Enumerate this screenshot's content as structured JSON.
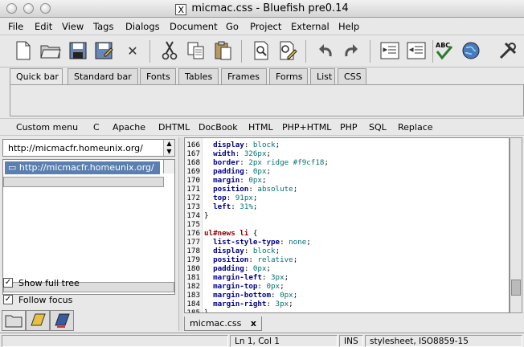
{
  "window": {
    "title": "micmac.css - Bluefish pre0.14",
    "x_glyph": "X"
  },
  "menu": [
    "File",
    "Edit",
    "View",
    "Tags",
    "Dialogs",
    "Document",
    "Go",
    "Project",
    "External",
    "Help"
  ],
  "toolbar_icons": [
    "new-file-icon",
    "open-folder-icon",
    "save-icon",
    "save-as-icon",
    "close-icon",
    "cut-icon",
    "copy-icon",
    "paste-icon",
    "find-icon",
    "replace-icon",
    "undo-icon",
    "redo-icon",
    "indent-icon",
    "unindent-icon",
    "spellcheck-icon",
    "preview-icon",
    "preferences-icon"
  ],
  "tabs": [
    "Quick bar",
    "Standard bar",
    "Fonts",
    "Tables",
    "Frames",
    "Forms",
    "List",
    "CSS"
  ],
  "custom_menu": [
    "Custom menu",
    "C",
    "Apache",
    "DHTML",
    "DocBook",
    "HTML",
    "PHP+HTML",
    "PHP",
    "SQL",
    "Replace"
  ],
  "filebrowser": {
    "location": "http://micmacfr.homeunix.org/",
    "selected": "http://micmacfr.homeunix.org/",
    "show_full_tree_label": "Show full tree",
    "follow_focus_label": "Follow focus",
    "check_mark": "✓"
  },
  "editor": {
    "lines": [
      {
        "n": "166",
        "p": "display",
        "v": "block"
      },
      {
        "n": "167",
        "p": "width",
        "v": "326px"
      },
      {
        "n": "168",
        "p": "border",
        "v": "2px ridge #f9cf18"
      },
      {
        "n": "169",
        "p": "padding",
        "v": "0px"
      },
      {
        "n": "170",
        "p": "margin",
        "v": "0px"
      },
      {
        "n": "171",
        "p": "position",
        "v": "absolute"
      },
      {
        "n": "172",
        "p": "top",
        "v": "91px"
      },
      {
        "n": "173",
        "p": "left",
        "v": "31%"
      },
      {
        "n": "174",
        "t": "}"
      },
      {
        "n": "175",
        "t": ""
      },
      {
        "n": "176",
        "s": "ul#news li",
        "t": " {"
      },
      {
        "n": "177",
        "p": "list-style-type",
        "v": "none"
      },
      {
        "n": "178",
        "p": "display",
        "v": "block"
      },
      {
        "n": "179",
        "p": "position",
        "v": "relative"
      },
      {
        "n": "180",
        "p": "padding",
        "v": "0px"
      },
      {
        "n": "181",
        "p": "margin-left",
        "v": "3px"
      },
      {
        "n": "182",
        "p": "margin-top",
        "v": "0px"
      },
      {
        "n": "183",
        "p": "margin-bottom",
        "v": "0px"
      },
      {
        "n": "184",
        "p": "margin-right",
        "v": "3px"
      },
      {
        "n": "185",
        "t": "}"
      }
    ],
    "tab_label": "micmac.css",
    "tab_close": "x"
  },
  "status": {
    "position": "Ln 1, Col 1",
    "mode": "INS",
    "filetype": "stylesheet, ISO8859-15"
  }
}
